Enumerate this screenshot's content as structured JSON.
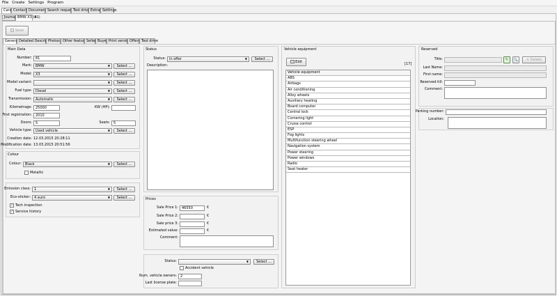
{
  "menu": [
    "File",
    "Create",
    "Settings",
    "Program"
  ],
  "top_tabs": [
    "Cars",
    "Contacts",
    "Documents",
    "Search requests",
    "Test drive",
    "Extras",
    "Settings"
  ],
  "sub_tabs": {
    "journal": "Journal",
    "vehicle": "BMW X3 (81)",
    "close": "✕"
  },
  "toolbar": {
    "save": "Save"
  },
  "section_tabs": [
    "General",
    "Detailed Description",
    "Photos",
    "Other features",
    "Seller",
    "Buyer",
    "Print version",
    "Offers",
    "Test drive"
  ],
  "main": {
    "title": "Main Data",
    "number_label": "Number:",
    "number": "81",
    "mark_label": "Mark:",
    "mark": "BMW",
    "model_label": "Model:",
    "model": "X3",
    "model_variant_label": "Model variant:",
    "model_variant": "",
    "fuel_label": "Fuel type:",
    "fuel": "Diesel",
    "transmission_label": "Transmission:",
    "transmission": "Automatic",
    "km_label": "Kilometrage:",
    "km": "25000",
    "kw_label": "KW (HP):",
    "kw": "",
    "first_reg_label": "First registration:",
    "first_reg": "2010",
    "doors_label": "Doors:",
    "doors": "5",
    "seats_label": "Seats:",
    "seats": "5",
    "vehicle_type_label": "Vehicle type:",
    "vehicle_type": "Used vehicle",
    "creation_label": "Creation date:",
    "creation": "12.03.2015  20:28:11",
    "modification_label": "Modification date:",
    "modification": "13.03.2015  20:51:56",
    "select": "Select ..."
  },
  "colour": {
    "title": "Colour",
    "label": "Colour:",
    "value": "Black",
    "metallic": "Metallic"
  },
  "emission": {
    "class_label": "Emission class:",
    "class": "1",
    "sticker_label": "Eco-sticker:",
    "sticker": "4 euro",
    "tech": "Tech inspection",
    "history": "Service history"
  },
  "status": {
    "title": "Status",
    "status_label": "Status:",
    "status": "In offer",
    "desc_label": "Description:"
  },
  "prices": {
    "title": "Prices",
    "p1_label": "Sale Price 1:",
    "p1": "46550",
    "p2_label": "Sale Price 2:",
    "p3_label": "Sale price 3:",
    "est_label": "Estimated value:",
    "comment_label": "Comment:",
    "currency": "€"
  },
  "condition": {
    "status_label": "Status:",
    "status": "",
    "accident": "Accident vehicle",
    "owners_label": "Num. vehicle owners:",
    "owners": "2",
    "license_label": "Last license plate:",
    "license": ""
  },
  "equipment": {
    "title": "Vehicle equipment",
    "edit": "Edit",
    "count": "[17]",
    "header": "Vehicle equipment",
    "items": [
      "ABS",
      "Airbags",
      "Air conditioning",
      "Alloy wheels",
      "Auxiliary heating",
      "Board computer",
      "Central lock",
      "Cornering light",
      "Cruise control",
      "ESP",
      "Fog lights",
      "Multifunction steering wheel",
      "Navigation system",
      "Power steering",
      "Power windows",
      "Radio",
      "Seat heater"
    ]
  },
  "reserved": {
    "title": "Reserved",
    "title_label": "Title:",
    "delete": "Delete",
    "last_label": "Last Name:",
    "first_label": "First name:",
    "till_label": "Reserved till:",
    "comment_label": "Comment:",
    "parking_label": "Parking number:",
    "location_label": "Location:"
  },
  "colors": {
    "accent": "#4a8a3a",
    "border": "#8e8e8e"
  }
}
